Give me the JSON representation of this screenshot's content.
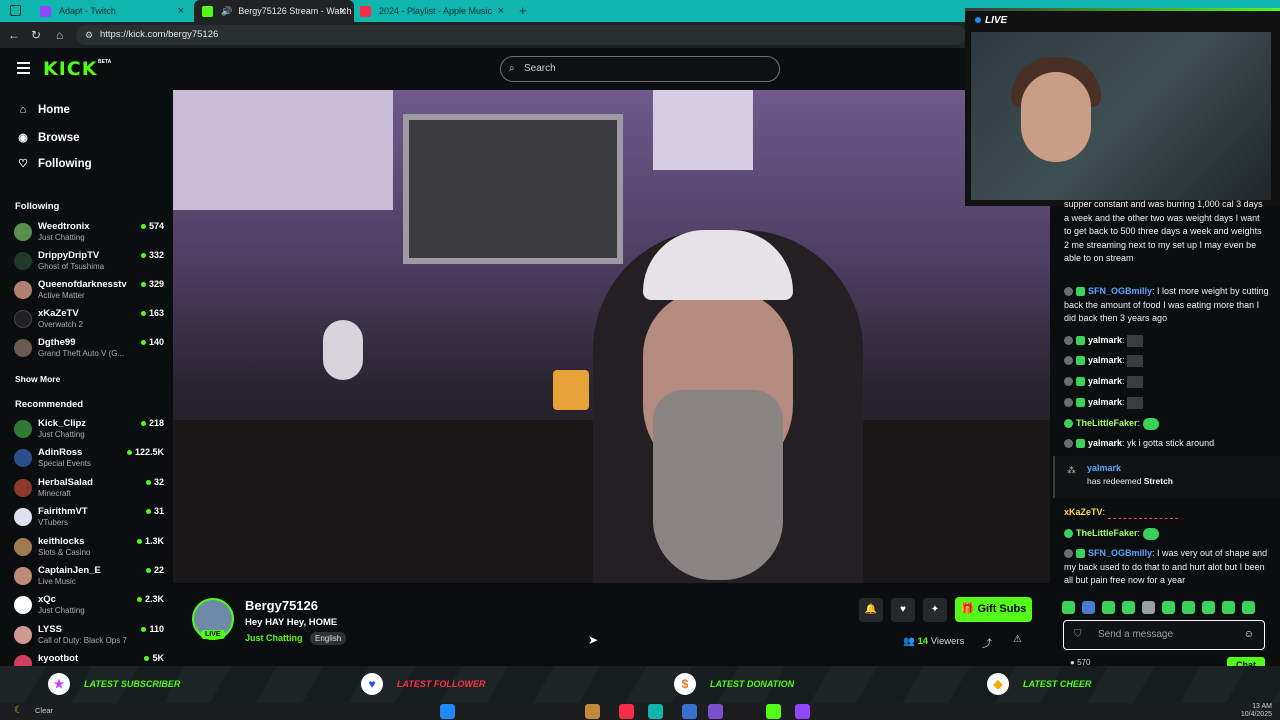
{
  "browser": {
    "tabs": [
      {
        "title": "Adapt - Twitch",
        "color": "#9147ff"
      },
      {
        "title": "Bergy75126 Stream - Watch",
        "color": "#53fc18"
      },
      {
        "title": "2024 - Playlist - Apple Music",
        "color": "#fa2d48"
      }
    ],
    "new_tab": "+",
    "url": "https://kick.com/bergy75126"
  },
  "header": {
    "logo": "KICK",
    "beta": "BETA",
    "search_placeholder": "Search"
  },
  "sidebar": {
    "nav": [
      {
        "label": "Home",
        "icon": "home-icon"
      },
      {
        "label": "Browse",
        "icon": "compass-icon"
      },
      {
        "label": "Following",
        "icon": "heart-icon"
      }
    ],
    "following_heading": "Following",
    "following": [
      {
        "name": "Weedtronix",
        "category": "Just Chatting",
        "viewers": "574",
        "color": "#5a8f4d"
      },
      {
        "name": "DrippyDripTV",
        "category": "Ghost of Tsushima",
        "viewers": "332",
        "color": "#1f3a2a"
      },
      {
        "name": "Queenofdarknesstv",
        "category": "Active Matter",
        "viewers": "329",
        "color": "#b08070"
      },
      {
        "name": "xKaZeTV",
        "category": "Overwatch 2",
        "viewers": "163",
        "color": "#202020"
      },
      {
        "name": "Dgthe99",
        "category": "Grand Theft Auto V (G...",
        "viewers": "140",
        "color": "#6a5a50"
      }
    ],
    "show_more": "Show More",
    "recommended_heading": "Recommended",
    "recommended": [
      {
        "name": "Kick_Clipz",
        "category": "Just Chatting",
        "viewers": "218",
        "color": "#2f7a35"
      },
      {
        "name": "AdinRoss",
        "category": "Special Events",
        "viewers": "122.5K",
        "color": "#2b4f8a"
      },
      {
        "name": "HerbalSalad",
        "category": "Minecraft",
        "viewers": "32",
        "color": "#8b3a2a"
      },
      {
        "name": "FairithmVT",
        "category": "VTubers",
        "viewers": "31",
        "color": "#e0e0f0"
      },
      {
        "name": "keithlocks",
        "category": "Slots & Casino",
        "viewers": "1.3K",
        "color": "#a07a50"
      },
      {
        "name": "CaptainJen_E",
        "category": "Live Music",
        "viewers": "22",
        "color": "#c08a7a"
      },
      {
        "name": "xQc",
        "category": "Just Chatting",
        "viewers": "2.3K",
        "color": "#ffffff"
      },
      {
        "name": "LYSS",
        "category": "Call of Duty: Black Ops 7",
        "viewers": "110",
        "color": "#d09a90"
      },
      {
        "name": "kyootbot",
        "category": "",
        "viewers": "5K",
        "color": "#d04060"
      }
    ]
  },
  "stream": {
    "channel": "Bergy75126",
    "title": "Hey HAY Hey, HOME",
    "category": "Just Chatting",
    "language": "English",
    "live_badge": "LIVE",
    "gift_subs": "Gift Subs",
    "viewers_count": "14",
    "viewers_label": "Viewers"
  },
  "webcam": {
    "live_label": "LIVE"
  },
  "chat": {
    "messages": [
      {
        "user": "",
        "text": "supper constant and was burring 1,000 cal 3 days a week and the other two was weight days I want to get back to 500 three days a week and weights 2 me streaming next to my set up I may even be able to on stream",
        "user_class": "user-white"
      },
      {
        "user": "SFN_OGBmilly",
        "text": "I lost more weight by cutting back the amount of food I was eating more than I did back then 3 years ago",
        "user_class": "user-blue"
      },
      {
        "user": "yalmark",
        "text": "",
        "user_class": "user-white"
      },
      {
        "user": "yalmark",
        "text": "",
        "user_class": "user-white"
      },
      {
        "user": "yalmark",
        "text": "",
        "user_class": "user-white"
      },
      {
        "user": "yalmark",
        "text": "",
        "user_class": "user-white"
      },
      {
        "user": "TheLittleFaker",
        "text": "",
        "user_class": "user-green"
      },
      {
        "user": "yalmark",
        "text": "yk i gotta stick around",
        "user_class": "user-white"
      },
      {
        "user": "xKaZeTV",
        "text": "",
        "user_class": "user-yellow"
      },
      {
        "user": "TheLittleFaker",
        "text": "",
        "user_class": "user-green"
      },
      {
        "user": "SFN_OGBmilly",
        "text": "I was very out of shape and my back used to do that to and hurt alot but I been all but pain free now for a year",
        "user_class": "user-blue"
      }
    ],
    "redeem": {
      "user": "yalmark",
      "text_prefix": "has redeemed",
      "reward": "Stretch"
    },
    "input_placeholder": "Send a message",
    "send_label": "Chat",
    "points": "570"
  },
  "alerts": {
    "items": [
      {
        "label": "LATEST SUBSCRIBER",
        "value": "",
        "icon": "star-icon",
        "icon_color": "#c040ff"
      },
      {
        "label": "LATEST FOLLOWER",
        "value": "",
        "icon": "heart-icon",
        "icon_color": "#1e50ff"
      },
      {
        "label": "LATEST DONATION",
        "value": "",
        "icon": "dollar-icon",
        "icon_color": "#e07a20"
      },
      {
        "label": "LATEST CHEER",
        "value": "",
        "icon": "diamond-icon",
        "icon_color": "#f0b000"
      }
    ]
  },
  "taskbar": {
    "weather": "Clear",
    "time": "13 AM",
    "date": "10/4/2025"
  }
}
